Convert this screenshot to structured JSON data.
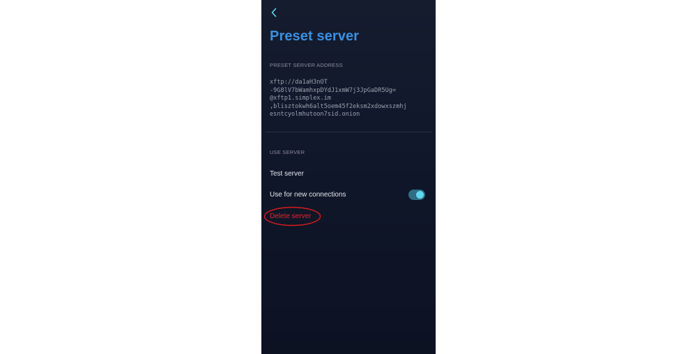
{
  "header": {
    "back_icon": "chevron-left-icon",
    "title": "Preset server"
  },
  "address_section": {
    "label": "PRESET SERVER ADDRESS",
    "address_lines": [
      "xftp://da1aH3nOT",
      "-9G8lV7bWamhxpDYdJ1xmW7j3JpGaDR5Ug=",
      "@xftp1.simplex.im",
      ",blisztokwh6alt5oem45f2eksm2xdowxszmhj",
      "esntcyolmhutoon7sid.onion"
    ]
  },
  "use_section": {
    "label": "USE SERVER",
    "test_server": "Test server",
    "use_for_new_connections": "Use for new connections",
    "use_for_new_connections_enabled": true,
    "delete_server": "Delete server"
  },
  "colors": {
    "title": "#3b8fe0",
    "accent": "#5fd8f2",
    "danger": "#e2262b",
    "annotation": "#d81b1b"
  }
}
